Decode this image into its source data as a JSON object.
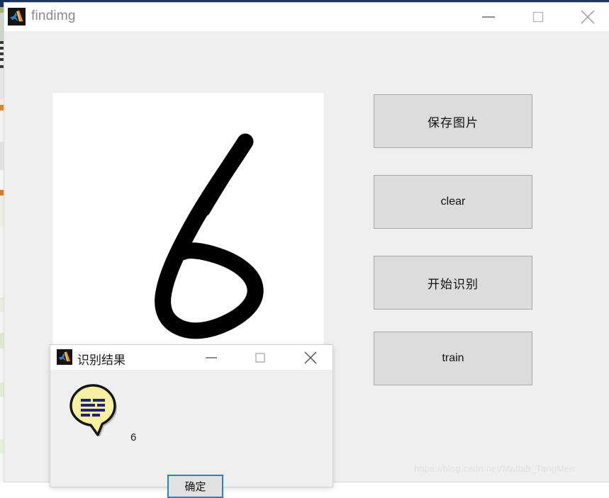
{
  "window": {
    "title": "findimg",
    "icon": "matlab-icon",
    "controls": [
      {
        "name": "minimize",
        "glyph": "minimize-icon"
      },
      {
        "name": "maximize",
        "glyph": "maximize-icon"
      },
      {
        "name": "close",
        "glyph": "close-icon"
      }
    ],
    "background_color": "#efefef",
    "titlebar_color": "#ffffff"
  },
  "canvas": {
    "name": "drawing-canvas",
    "background_color": "#ffffff",
    "stroke_color": "#000000",
    "drawn_digit": "6"
  },
  "buttons": [
    {
      "id": "save",
      "label": "保存图片",
      "lang": "cn"
    },
    {
      "id": "clear",
      "label": "clear",
      "lang": "en"
    },
    {
      "id": "detect",
      "label": "开始识别",
      "lang": "cn"
    },
    {
      "id": "train",
      "label": "train",
      "lang": "en"
    }
  ],
  "button_style": {
    "fill": "#dcdcdc",
    "border": "#a9a9a9"
  },
  "dialog": {
    "title": "识别结果",
    "icon": "matlab-icon",
    "message": "6",
    "message_icon": "speech-bubble-icon",
    "message_icon_fill": "#f5ee9a",
    "message_icon_lines": "#22227a",
    "ok_label": "确定",
    "ok_border_color": "#2f7fc1",
    "controls": [
      {
        "name": "minimize",
        "glyph": "minimize-icon"
      },
      {
        "name": "maximize",
        "glyph": "maximize-icon"
      },
      {
        "name": "close",
        "glyph": "close-icon"
      }
    ]
  },
  "watermark": {
    "text": "https://blog.csdn.net/Matlab_TangMen",
    "color": "#e2e2e2"
  }
}
